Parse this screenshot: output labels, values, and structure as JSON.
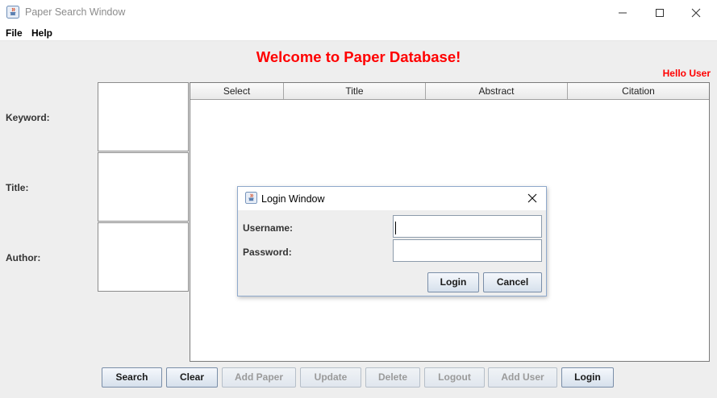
{
  "window": {
    "title": "Paper Search Window",
    "menus": [
      "File",
      "Help"
    ]
  },
  "header": {
    "welcome": "Welcome to Paper Database!",
    "greeting": "Hello User"
  },
  "search_fields": [
    {
      "label": "Keyword:",
      "value": ""
    },
    {
      "label": "Title:",
      "value": ""
    },
    {
      "label": "Author:",
      "value": ""
    }
  ],
  "table": {
    "columns": [
      "Select",
      "Title",
      "Abstract",
      "Citation"
    ],
    "rows": []
  },
  "buttons": [
    {
      "label": "Search",
      "enabled": true
    },
    {
      "label": "Clear",
      "enabled": true
    },
    {
      "label": "Add Paper",
      "enabled": false
    },
    {
      "label": "Update",
      "enabled": false
    },
    {
      "label": "Delete",
      "enabled": false
    },
    {
      "label": "Logout",
      "enabled": false
    },
    {
      "label": "Add User",
      "enabled": false
    },
    {
      "label": "Login",
      "enabled": true
    }
  ],
  "login_dialog": {
    "title": "Login Window",
    "username_label": "Username:",
    "username_value": "",
    "password_label": "Password:",
    "password_value": "",
    "login_label": "Login",
    "cancel_label": "Cancel"
  },
  "colors": {
    "accent_text": "#ff0000",
    "dialog_border": "#8fa9cc"
  },
  "icons": [
    "java-cup-icon",
    "minimize-icon",
    "maximize-icon",
    "close-icon"
  ]
}
